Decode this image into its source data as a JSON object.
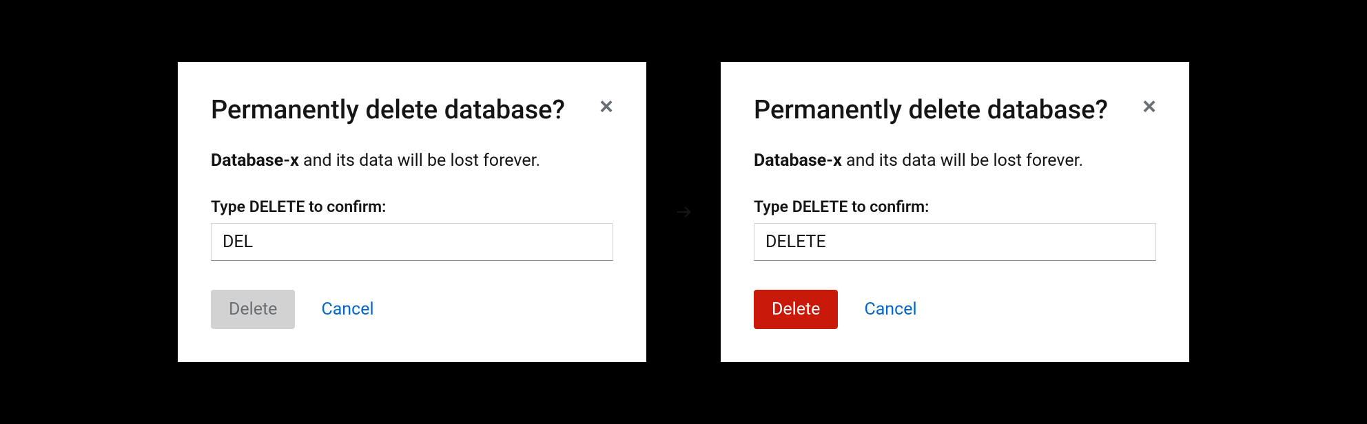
{
  "modal_left": {
    "title": "Permanently delete database?",
    "body_bold": "Database-x",
    "body_rest": " and its data will be lost forever.",
    "input_label": "Type DELETE to confirm:",
    "input_value": "DEL",
    "delete_label": "Delete",
    "cancel_label": "Cancel",
    "delete_enabled": false
  },
  "modal_right": {
    "title": "Permanently delete database?",
    "body_bold": "Database-x",
    "body_rest": " and its data will be lost forever.",
    "input_label": "Type DELETE to confirm:",
    "input_value": "DELETE",
    "delete_label": "Delete",
    "cancel_label": "Cancel",
    "delete_enabled": true
  }
}
